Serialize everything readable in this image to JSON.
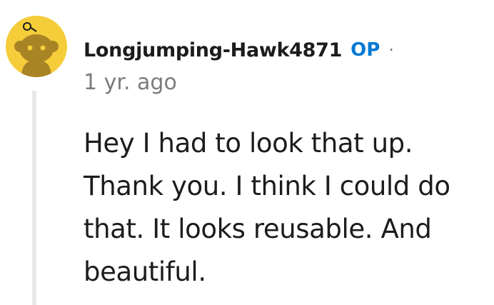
{
  "comment": {
    "avatar_icon": "reddit-snoo-avatar-icon",
    "username": "Longjumping-Hawk4871",
    "op_badge": "OP",
    "separator": "·",
    "timestamp": "1 yr. ago",
    "body": "Hey I had to look that up. Thank you. I think I could do that. It looks reusable. And beautiful."
  },
  "colors": {
    "avatar_background": "#f5cd3a",
    "avatar_figure": "#a98424",
    "username": "#1c1c1c",
    "op_badge": "#0079d3",
    "meta_text": "#7c7c7c",
    "thread_line": "#e6e8ea",
    "body_text": "#1c1c1c"
  }
}
